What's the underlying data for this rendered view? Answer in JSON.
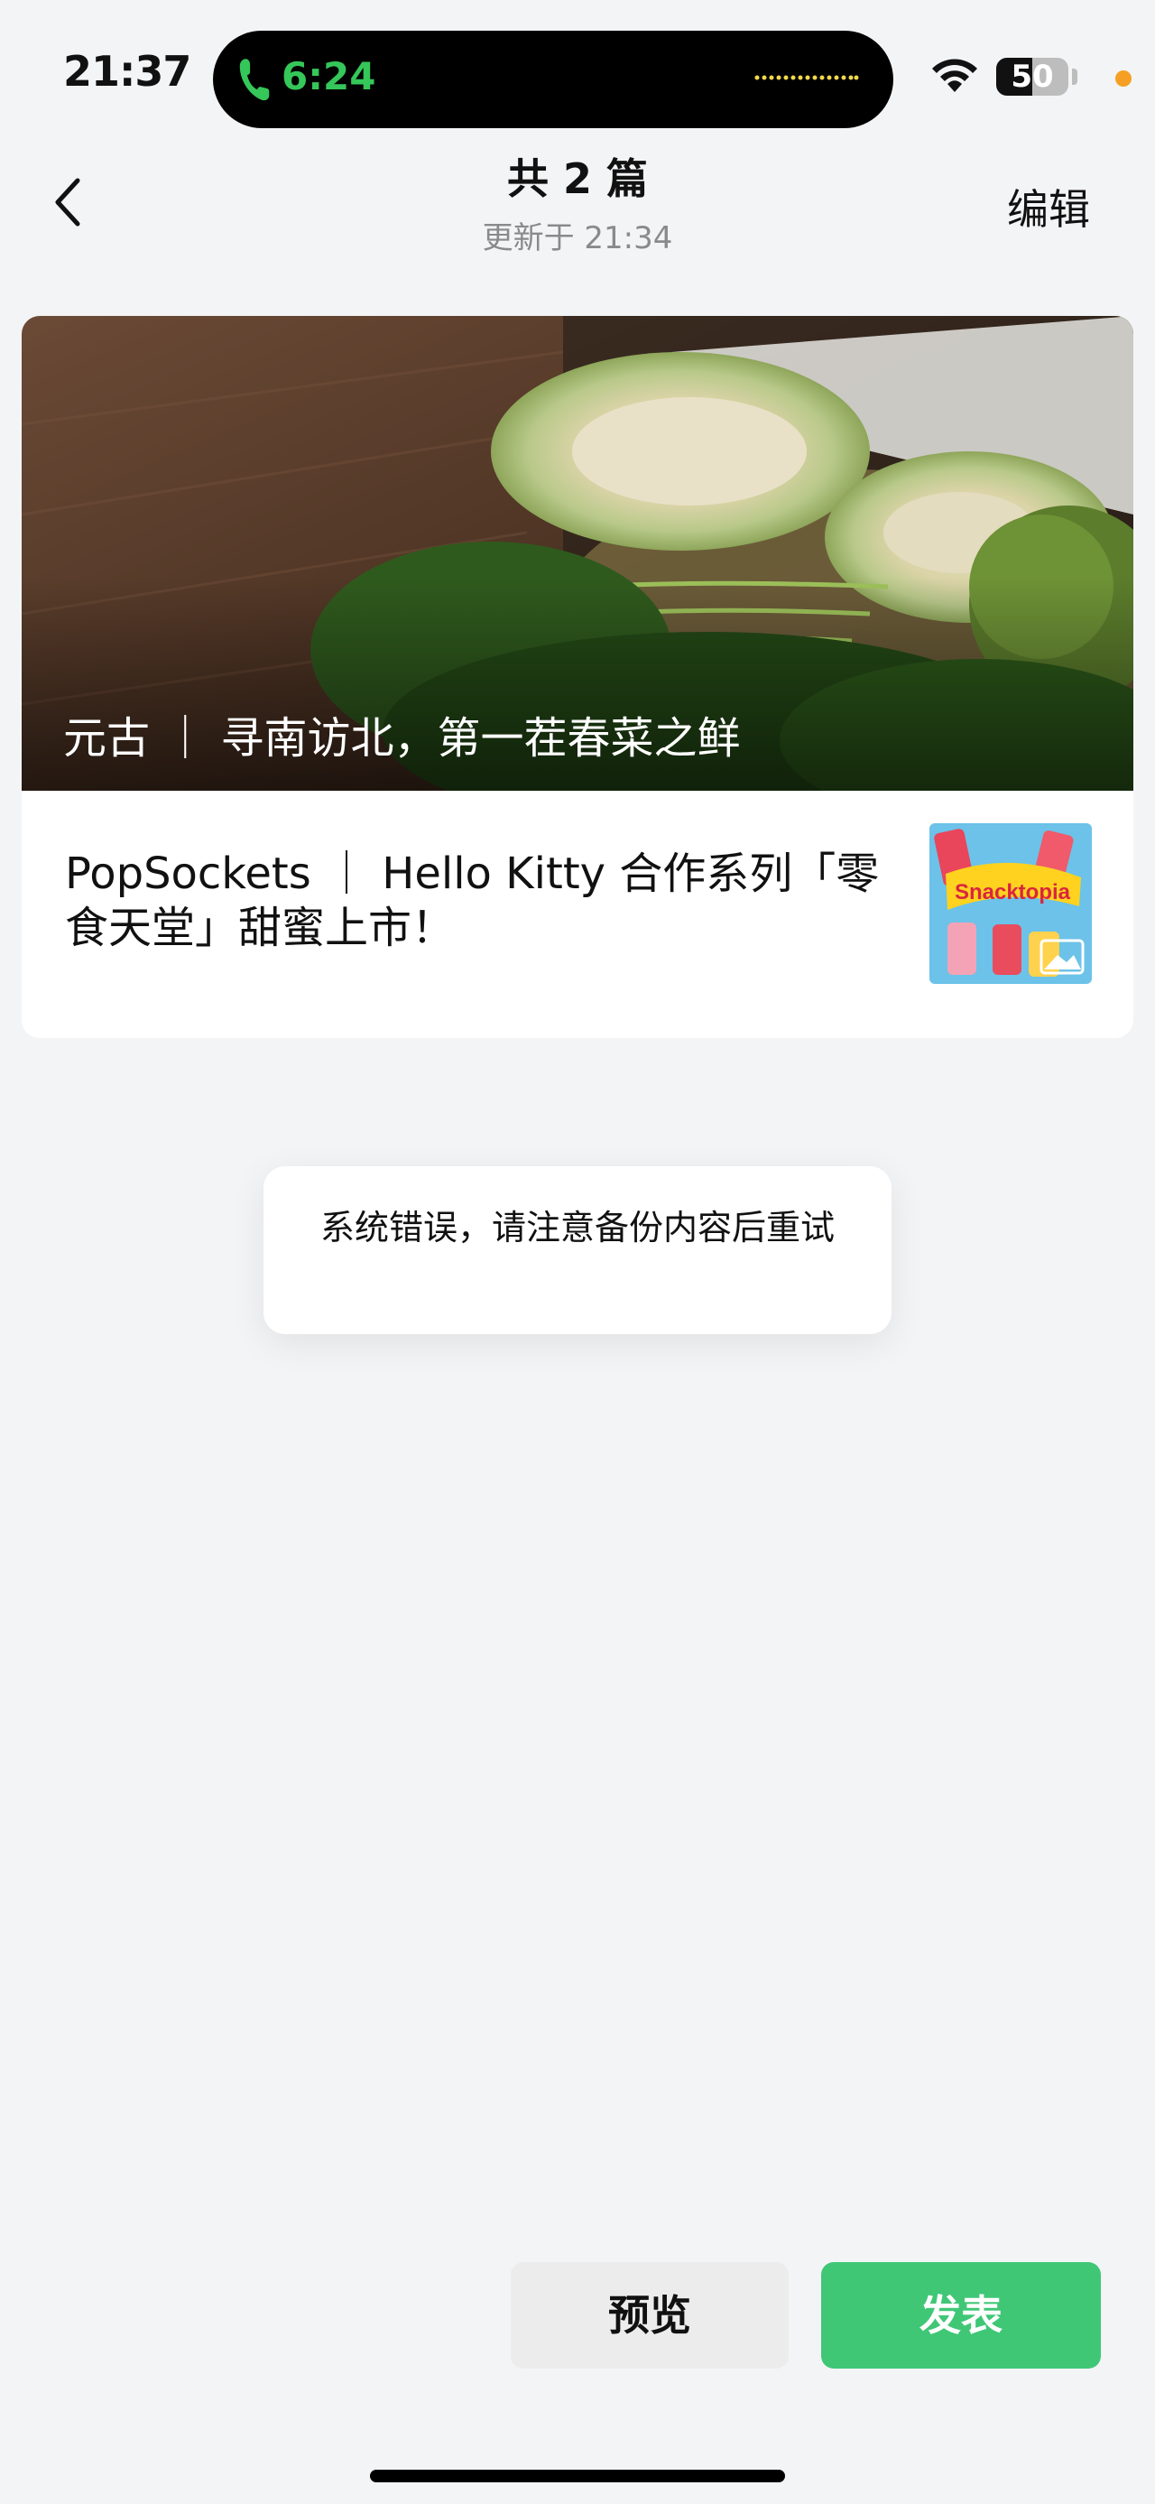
{
  "status_bar": {
    "time": "21:37",
    "call_timer": "6:24",
    "battery_percent": "50",
    "battery_level": 0.5
  },
  "nav": {
    "title": "共 2 篇",
    "subtitle": "更新于 21:34",
    "edit_label": "编辑"
  },
  "articles": [
    {
      "title": "元古 ｜ 寻南访北，第一茬春菜之鲜"
    },
    {
      "title": "PopSockets ｜ Hello Kitty 合作系列「零食天堂」甜蜜上市！"
    }
  ],
  "thumbnail": {
    "brand_text": "Snacktopia"
  },
  "toast": {
    "message": "系统错误，请注意备份内容后重试"
  },
  "actions": {
    "preview_label": "预览",
    "publish_label": "发表"
  },
  "colors": {
    "publish_green": "#3fc776",
    "call_green": "#35c759",
    "background": "#f3f4f6"
  }
}
